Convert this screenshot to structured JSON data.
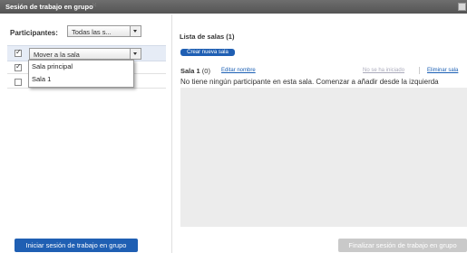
{
  "window": {
    "title": "Sesión de trabajo en grupo",
    "grip": "⁙"
  },
  "participants": {
    "label": "Participantes:",
    "filter_value": "Todas las s...",
    "rows": [
      {
        "checked": true,
        "move_value": "Mover a la sala"
      },
      {
        "checked": true
      },
      {
        "checked": false
      }
    ],
    "menu_options": [
      "Sala principal",
      "Sala 1"
    ]
  },
  "rooms": {
    "title": "Lista de salas (1)",
    "create_label": "Crear nueva sala",
    "room1": {
      "name": "Sala 1",
      "count": "(0)",
      "edit_label": "Editar nombre",
      "status": "No se ha iniciado",
      "delete_label": "Eliminar sala",
      "empty_hint": "No tiene ningún participante en esta sala. Comenzar a añadir desde la izquierda"
    }
  },
  "footer": {
    "start_label": "Iniciar sesión de trabajo en grupo",
    "end_label": "Finalizar sesión de trabajo en grupo"
  }
}
